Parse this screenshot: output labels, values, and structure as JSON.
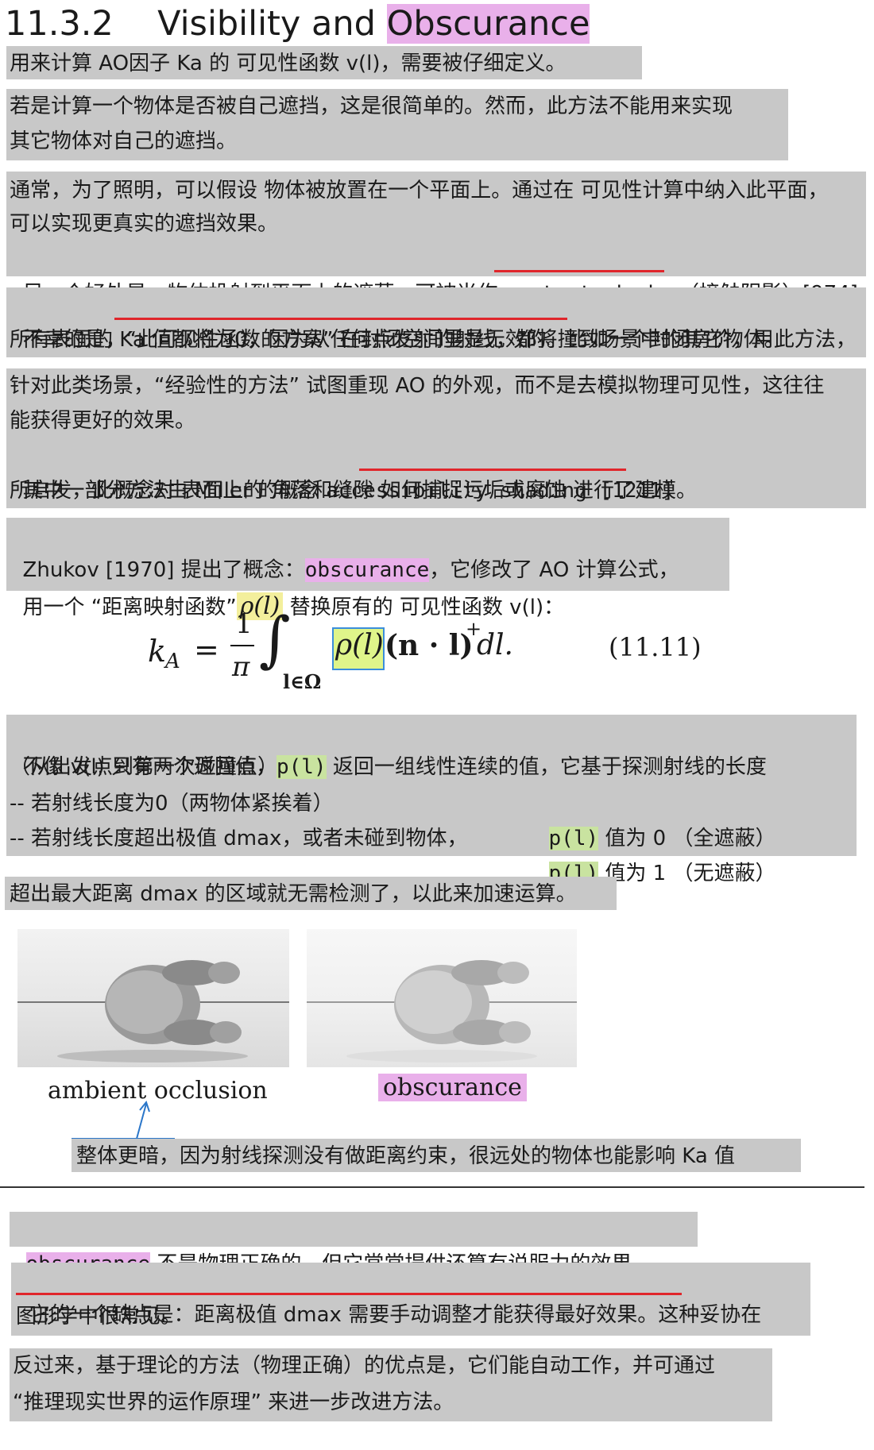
{
  "heading": {
    "number": "11.3.2",
    "title_a": "Visibility and ",
    "title_b": "Obscurance"
  },
  "p1": {
    "line1": "用来计算 AO因子 Ka 的 可见性函数 v(l)，需要被仔细定义。"
  },
  "p2": {
    "line1": "若是计算一个物体是否被自己遮挡，这是很简单的。然而，此方法不能用来实现",
    "line2": "其它物体对自己的遮挡。"
  },
  "p3": {
    "line1": "通常，为了照明，可以假设 物体被放置在一个平面上。通过在 可见性计算中纳入此平面，",
    "line2": "可以实现更真实的遮挡效果。",
    "line3_a": "另一个好处是，物体投射到平面上的遮蔽，可被当作 ",
    "line3_b": "contact shadow",
    "line3_c": "（接触阴影）[974]."
  },
  "p4": {
    "line1_a": "不幸的是，",
    "line1_b": "“此可见性函数的方案” 在封闭空间里是无效的",
    "line1_c": "。比如一个封闭房价，用此方法，",
    "line2": "所有表面的 Ka 值都将为0，因为从任何点发射的射线，都将撞到场景中的其它物体。"
  },
  "p5": {
    "line1": "针对此类场景，“经验性的方法” 试图重现 AO 的外观，而不是去模拟物理可见性，这往往",
    "line2": "能获得更好的效果。",
    "line3_a": "其中一部分方法由 Miller 的概念 ",
    "line3_b": "accessibility shading",
    "line3_c": " [1211]",
    "line4": "所启发，此概念对 表面上的 角落和缝隙 如何捕捉污垢或腐蚀 进行了建模。"
  },
  "p6": {
    "line1_a": "Zhukov [1970] 提出了概念：",
    "line1_b": "obscurance",
    "line1_c": "，它修改了 AO 计算公式，",
    "line2_a": "用一个 “距离映射函数”",
    "line2_b": "ρ(l)",
    "line2_c": "替换原有的 可见性函数 v(l)："
  },
  "equation": {
    "lhs": "k",
    "lhs_sub": "A",
    "equals": "=",
    "frac_num": "1",
    "frac_den": "π",
    "integral": "∫",
    "integral_sub": "l∈Ω",
    "rho": "ρ(l)",
    "rest": "(n · l)",
    "sup": "+",
    "tail": " dl.",
    "number": "(11.11)"
  },
  "p7": {
    "line1_a": "不像 v(l) 只有两个返回值，",
    "line1_b": "p(l)",
    "line1_c": " 返回一组线性连续的值，它基于探测射线的长度",
    "line2": "（从出发点到第一次碰撞点）",
    "line3_a": "-- 若射线长度为0（两物体紧挨着）",
    "line3_b": "p(l)",
    "line3_c": " 值为 0 （全遮蔽）",
    "line4_a": "-- 若射线长度超出极值 dmax，或者未碰到物体，",
    "line4_b": "p(l)",
    "line4_c": " 值为 1 （无遮蔽）"
  },
  "p8": {
    "line1": "超出最大距离 dmax 的区域就无需检测了，以此来加速运算。"
  },
  "figure": {
    "caption_left": "ambient occlusion",
    "caption_right": "obscurance",
    "note": "整体更暗，因为射线探测没有做距离约束，很远处的物体也能影响 Ka 值"
  },
  "p9": {
    "line1_a": "obscurance",
    "line1_b": " 不是物理正确的。但它常常提供还算有说服力的效果。"
  },
  "p10": {
    "line1_a": "它的一个缺点是：距离极值 dmax 需要手动调整才能获得最好效果",
    "line1_b": "。这种妥协在",
    "line2": "图形学中很常见。"
  },
  "p11": {
    "line1": "反过来，基于理论的方法（物理正确）的优点是，它们能自动工作，并可通过",
    "line2": "“推理现实世界的运作原理” 来进一步改进方法。"
  }
}
